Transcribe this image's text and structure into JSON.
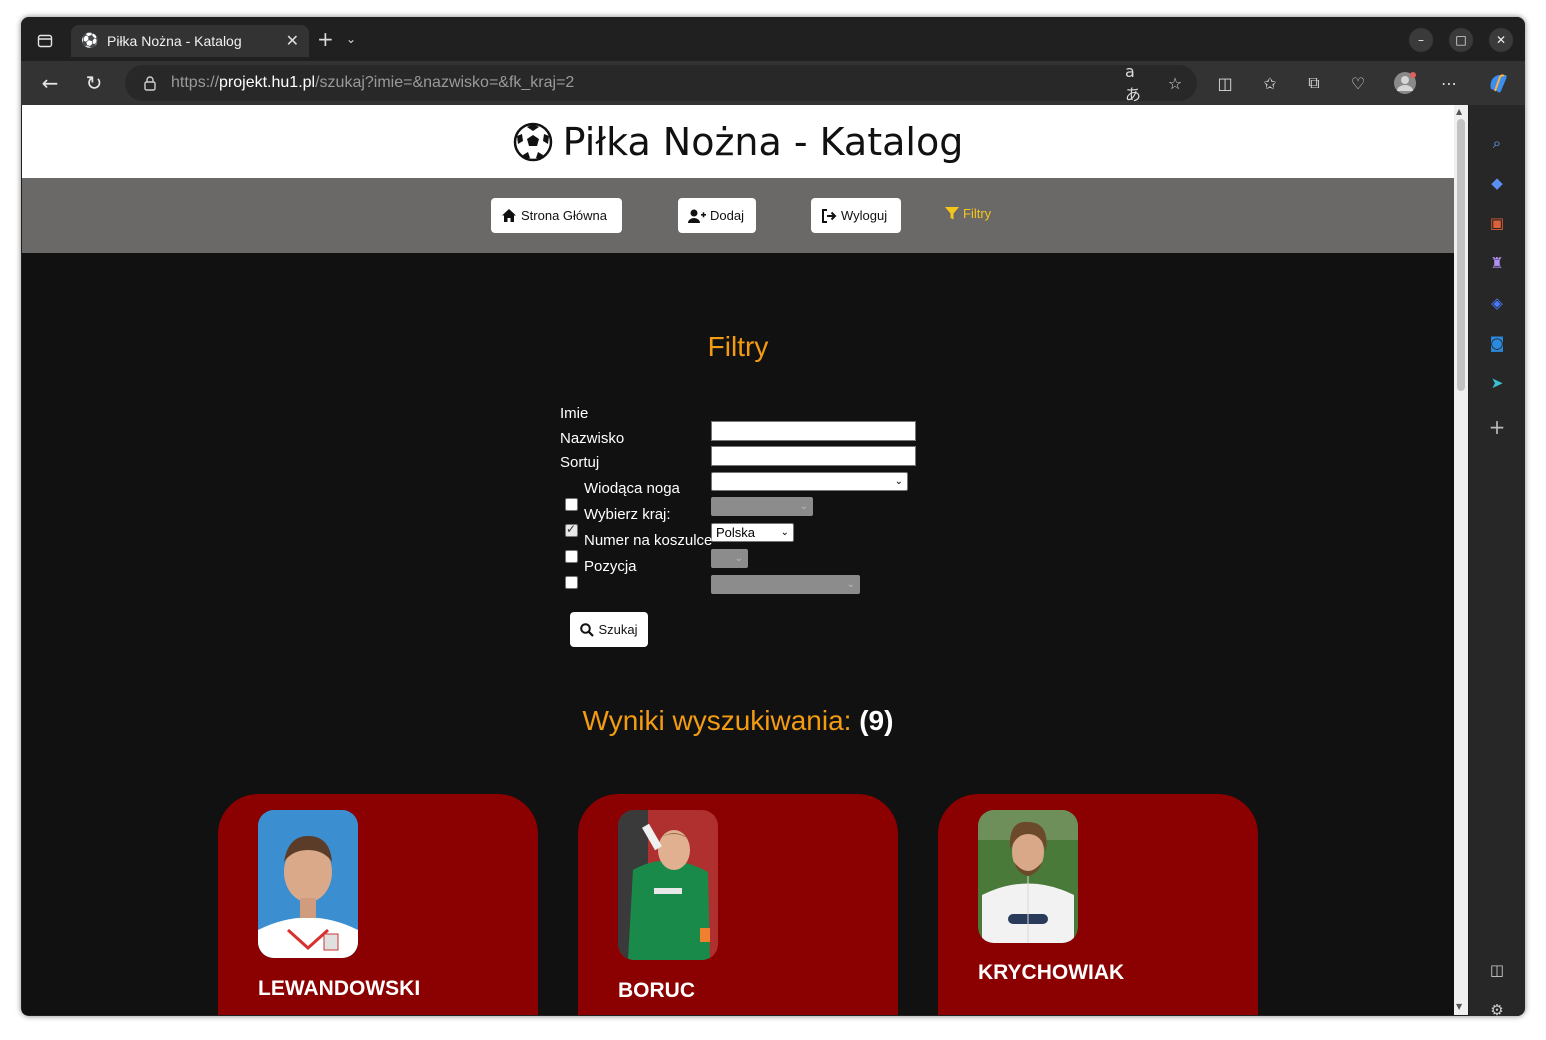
{
  "browser": {
    "tab_title": "Piłka Nożna - Katalog",
    "url_prefix": "https://",
    "url_host": "projekt.hu1.pl",
    "url_path": "/szukaj?imie=&nazwisko=&fk_kraj=2"
  },
  "site": {
    "title": "Piłka Nożna - Katalog"
  },
  "menu": {
    "home": "Strona Główna",
    "add": "Dodaj",
    "logout": "Wyloguj",
    "filters": "Filtry"
  },
  "filters": {
    "title": "Filtry",
    "name_label": "Imie",
    "name_value": "",
    "surname_label": "Nazwisko",
    "surname_value": "",
    "sort_label": "Sortuj",
    "sort_value": "",
    "foot_label": "Wiodąca noga",
    "foot_checked": false,
    "country_label": "Wybierz kraj:",
    "country_checked": true,
    "country_value": "Polska",
    "shirt_label": "Numer na koszulce",
    "shirt_checked": false,
    "position_label": "Pozycja",
    "position_checked": false,
    "search_button": "Szukaj"
  },
  "results": {
    "label": "Wyniki wyszukiwania:",
    "count": "(9)"
  },
  "players": [
    {
      "name": "LEWANDOWSKI",
      "shirt_color": "#ffffff",
      "bg": "#2a7fc0"
    },
    {
      "name": "BORUC",
      "shirt_color": "#1a8a4a",
      "bg": "#c0392b"
    },
    {
      "name": "KRYCHOWIAK",
      "shirt_color": "#f2f2f2",
      "bg": "#4a7a3a"
    }
  ],
  "colors": {
    "accent": "#f39c12",
    "card": "#8b0000",
    "menu_bg": "#6b6868",
    "filter_link": "#f5c518"
  }
}
